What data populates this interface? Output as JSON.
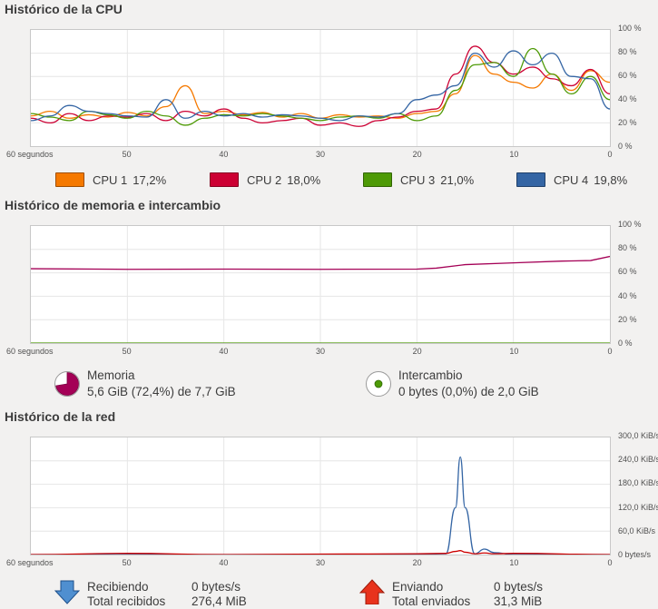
{
  "cpu": {
    "title": "Histórico de la CPU",
    "y_ticks": [
      "100 %",
      "80 %",
      "60 %",
      "40 %",
      "20 %",
      "0 %"
    ],
    "x_ticks": [
      "60 segundos",
      "50",
      "40",
      "30",
      "20",
      "10",
      "0"
    ],
    "legend": [
      {
        "name": "CPU 1",
        "value": "17,2%",
        "color": "#f57900"
      },
      {
        "name": "CPU 2",
        "value": "18,0%",
        "color": "#cc0033"
      },
      {
        "name": "CPU 3",
        "value": "21,0%",
        "color": "#4e9a06"
      },
      {
        "name": "CPU 4",
        "value": "19,8%",
        "color": "#3465a4"
      }
    ]
  },
  "memory": {
    "title": "Histórico de memoria e intercambio",
    "y_ticks": [
      "100 %",
      "80 %",
      "60 %",
      "40 %",
      "20 %",
      "0 %"
    ],
    "x_ticks": [
      "60 segundos",
      "50",
      "40",
      "30",
      "20",
      "10",
      "0"
    ],
    "mem_label": "Memoria",
    "mem_detail": "5,6 GiB (72,4%) de 7,7 GiB",
    "swap_label": "Intercambio",
    "swap_detail": "0 bytes (0,0%) de 2,0 GiB",
    "mem_color": "#a40056",
    "swap_color": "#4e9a06"
  },
  "network": {
    "title": "Histórico de la red",
    "y_ticks": [
      "300,0 KiB/s",
      "240,0 KiB/s",
      "180,0 KiB/s",
      "120,0 KiB/s",
      "60,0 KiB/s",
      "0 bytes/s"
    ],
    "x_ticks": [
      "60 segundos",
      "50",
      "40",
      "30",
      "20",
      "10",
      "0"
    ],
    "recv_label": "Recibiendo",
    "recv_value": "0 bytes/s",
    "recv_total_label": "Total recibidos",
    "recv_total_value": "276,4 MiB",
    "send_label": "Enviando",
    "send_value": "0 bytes/s",
    "send_total_label": "Total enviados",
    "send_total_value": "31,3 MiB",
    "recv_color": "#3465a4",
    "send_color": "#cc0000"
  },
  "chart_data": [
    {
      "type": "line",
      "title": "Histórico de la CPU",
      "x": [
        60,
        58,
        56,
        54,
        52,
        50,
        48,
        46,
        44,
        42,
        40,
        38,
        36,
        34,
        32,
        30,
        28,
        26,
        24,
        22,
        20,
        18,
        16,
        14,
        12,
        10,
        8,
        6,
        4,
        2,
        0
      ],
      "ylim": [
        0,
        100
      ],
      "series": [
        {
          "name": "CPU 1",
          "values": [
            26,
            30,
            24,
            27,
            25,
            29,
            26,
            34,
            52,
            28,
            30,
            27,
            29,
            25,
            28,
            24,
            27,
            25,
            26,
            24,
            28,
            30,
            45,
            78,
            62,
            55,
            50,
            62,
            48,
            65,
            55
          ]
        },
        {
          "name": "CPU 2",
          "values": [
            24,
            20,
            28,
            22,
            26,
            25,
            28,
            22,
            30,
            26,
            32,
            24,
            20,
            22,
            24,
            18,
            20,
            17,
            22,
            25,
            30,
            32,
            62,
            86,
            72,
            62,
            68,
            58,
            52,
            66,
            45
          ]
        },
        {
          "name": "CPU 3",
          "values": [
            28,
            25,
            22,
            30,
            27,
            24,
            30,
            26,
            18,
            24,
            27,
            26,
            28,
            26,
            24,
            22,
            25,
            26,
            24,
            28,
            22,
            26,
            48,
            70,
            72,
            60,
            84,
            62,
            45,
            60,
            40
          ]
        },
        {
          "name": "CPU 4",
          "values": [
            22,
            26,
            35,
            30,
            28,
            26,
            25,
            40,
            24,
            30,
            26,
            28,
            25,
            27,
            26,
            24,
            22,
            26,
            25,
            28,
            40,
            44,
            52,
            80,
            68,
            82,
            70,
            80,
            60,
            58,
            32
          ]
        }
      ]
    },
    {
      "type": "line",
      "title": "Histórico de memoria e intercambio",
      "x": [
        60,
        50,
        40,
        30,
        20,
        18,
        15,
        10,
        5,
        2,
        0
      ],
      "ylim": [
        0,
        100
      ],
      "series": [
        {
          "name": "Memoria",
          "values": [
            63.5,
            63.0,
            63.2,
            63.0,
            63.2,
            64.0,
            67.0,
            68.5,
            70.0,
            70.5,
            74.0
          ]
        },
        {
          "name": "Intercambio",
          "values": [
            0,
            0,
            0,
            0,
            0,
            0,
            0,
            0,
            0,
            0,
            0
          ]
        }
      ]
    },
    {
      "type": "line",
      "title": "Histórico de la red",
      "x": [
        60,
        50,
        40,
        30,
        20,
        17,
        16,
        15.5,
        15,
        14,
        13,
        12,
        10,
        0
      ],
      "ylim": [
        0,
        300
      ],
      "series": [
        {
          "name": "Recibiendo",
          "values": [
            0,
            0,
            0,
            0,
            0,
            2,
            120,
            250,
            120,
            2,
            14,
            5,
            0,
            0
          ]
        },
        {
          "name": "Enviando",
          "values": [
            0,
            3,
            0,
            1,
            2,
            3,
            8,
            10,
            6,
            2,
            4,
            2,
            3,
            0
          ]
        }
      ]
    }
  ]
}
